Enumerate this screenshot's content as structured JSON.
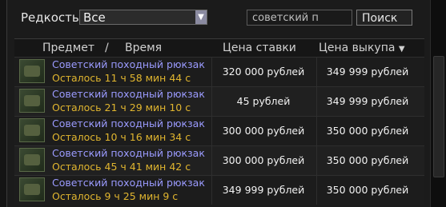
{
  "filter": {
    "rarity_label": "Редкость",
    "rarity_value": "Все",
    "search_value": "советский п",
    "search_button": "Поиск"
  },
  "columns": {
    "item": "Предмет",
    "separator": "/",
    "time": "Время",
    "bid_price": "Цена ставки",
    "buyout_price": "Цена выкупа",
    "sort_icon": "triangle-down-icon"
  },
  "rows": [
    {
      "name": "Советский походный рюкзак",
      "time_left": "Осталось 11 ч 58 мин 44 с",
      "bid": "320 000 рублей",
      "buyout": "349 999 рублей"
    },
    {
      "name": "Советский походный рюкзак",
      "time_left": "Осталось 21 ч 29 мин 10 с",
      "bid": "45 рублей",
      "buyout": "349 999 рублей"
    },
    {
      "name": "Советский походный рюкзак",
      "time_left": "Осталось 10 ч 16 мин 34 с",
      "bid": "300 000 рублей",
      "buyout": "350 000 рублей"
    },
    {
      "name": "Советский походный рюкзак",
      "time_left": "Осталось 45 ч 41 мин 42 с",
      "bid": "300 000 рублей",
      "buyout": "350 000 рублей"
    },
    {
      "name": "Советский походный рюкзак",
      "time_left": "Осталось 9 ч 25 мин 9 с",
      "bid": "349 999 рублей",
      "buyout": "350 000 рублей"
    }
  ],
  "colors": {
    "item_name": "#9b9bff",
    "time_left": "#e0b52f",
    "price": "#f2f2f2",
    "background": "#1b1b1b"
  }
}
